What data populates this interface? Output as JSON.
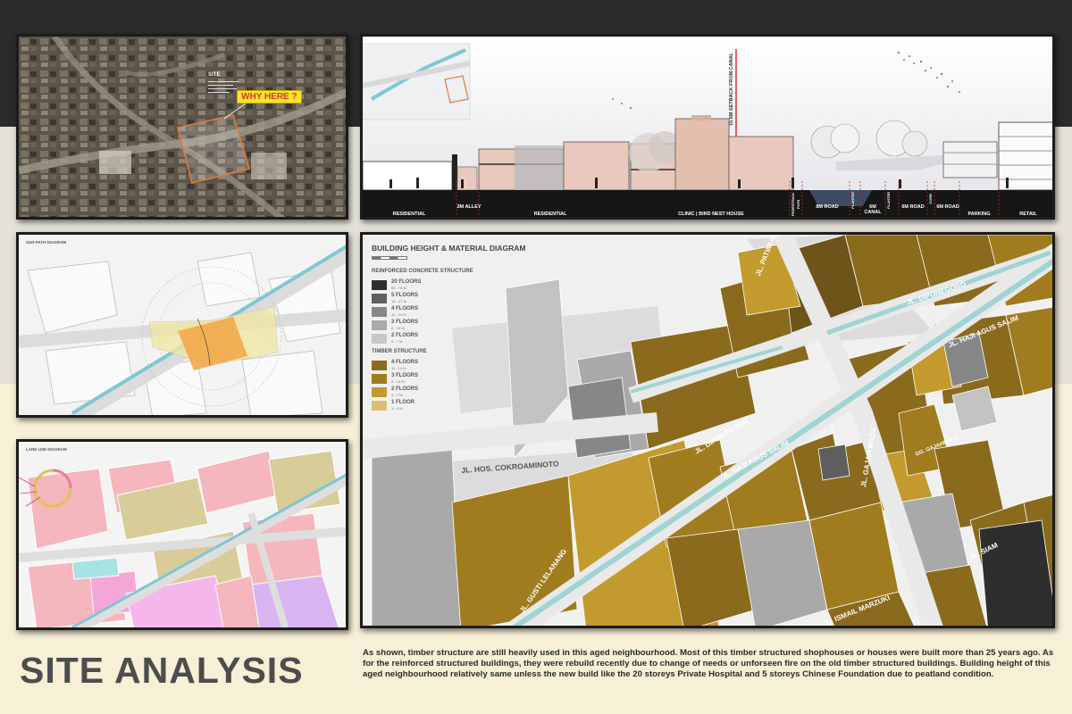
{
  "title": "SITE ANALYSIS",
  "description": "As shown, timber structure are still heavily used in this aged neighbourhood. Most of this timber structured shophouses or houses were built more than 25 years ago. As for the reinforced structured buildings, they were rebuild recently due to change of needs or unforseen fire on the old timber structured buildings. Building height of this aged neighbourhood relatively same  unless the new build like the 20 storeys Private Hospital and 5 storeys Chinese Foundation due to peatland condition.",
  "aerial": {
    "site_label": "SITE",
    "callout": "WHY HERE ?"
  },
  "section": {
    "setback_label": "15.5M SETBACK FROM CANAL",
    "labels": [
      {
        "text": "RESIDENTIAL"
      },
      {
        "text": "3M ALLEY"
      },
      {
        "text": "RESIDENTIAL"
      },
      {
        "text": "CLINIC | BIRD NEST HOUSE"
      },
      {
        "text": "PEDESTRIAN PATH"
      },
      {
        "text": "8M ROAD"
      },
      {
        "text": "PLANTER"
      },
      {
        "text": "6M CANAL"
      },
      {
        "text": "PLANTER"
      },
      {
        "text": "6M ROAD"
      },
      {
        "text": "CURB"
      },
      {
        "text": "6M ROAD"
      },
      {
        "text": "PARKING"
      },
      {
        "text": "RETAIL"
      }
    ]
  },
  "sun_path": {
    "title": "SUN PATH DIAGRAM"
  },
  "land_use": {
    "title": "LAND USE DIAGRAM"
  },
  "height_diagram": {
    "title": "BUILDING HEIGHT & MATERIAL DIAGRAM",
    "rc_heading": "REINFORCED CONCRETE STRUCTURE",
    "rc_items": [
      {
        "label": "20 FLOORS",
        "sub": "50 - 70 M",
        "color": "#2e2e2e"
      },
      {
        "label": "5 FLOORS",
        "sub": "15 - 17 M",
        "color": "#5e5e5e"
      },
      {
        "label": "4 FLOORS",
        "sub": "11 - 14 M",
        "color": "#878787"
      },
      {
        "label": "3 FLOORS",
        "sub": "8 - 10 M",
        "color": "#a9a9a9"
      },
      {
        "label": "2 FLOORS",
        "sub": "5 - 7 M",
        "color": "#c8c8c8"
      }
    ],
    "timber_heading": "TIMBER STRUCTURE",
    "timber_items": [
      {
        "label": "4 FLOORS",
        "sub": "11 - 14 M",
        "color": "#8a6a1c"
      },
      {
        "label": "3 FLOORS",
        "sub": "8 - 10 M",
        "color": "#a07c1e"
      },
      {
        "label": "2 FLOORS",
        "sub": "5 - 7 M",
        "color": "#c29a2e"
      },
      {
        "label": "1 FLOOR",
        "sub": "3 - 4 M",
        "color": "#dcc070"
      }
    ],
    "streets": {
      "patimura": "JL. PATIMURA",
      "diponegoro_top": "JL. DIPONEGORO",
      "haji_agus_salim_top": "JL. HAJI AGUS SALIM",
      "hos_cokroaminoto": "JL. HOS. COKROAMINOTO",
      "diponegoro_mid": "JL. DIPONEGORO",
      "haji_agus_salim_mid": "JL. HAJI AGUS SALIM",
      "gajah_mada": "JL. GAJAH MADA",
      "gajahmada_small": "GG. GAJAHMADA",
      "siam": "JL. SIAM",
      "gusti_lelanang": "JL. GUSTI LELANANG",
      "ismail_marzuki": "JL. ISMAIL MARZUKI"
    }
  },
  "colors": {
    "timber_dark": "#8a6a1c",
    "timber_mid": "#a07c1e",
    "timber_light": "#c29a2e",
    "canal": "#9fd4d4",
    "section_ground": "#1a1a1a",
    "building_pink": "#e9c9bd"
  }
}
